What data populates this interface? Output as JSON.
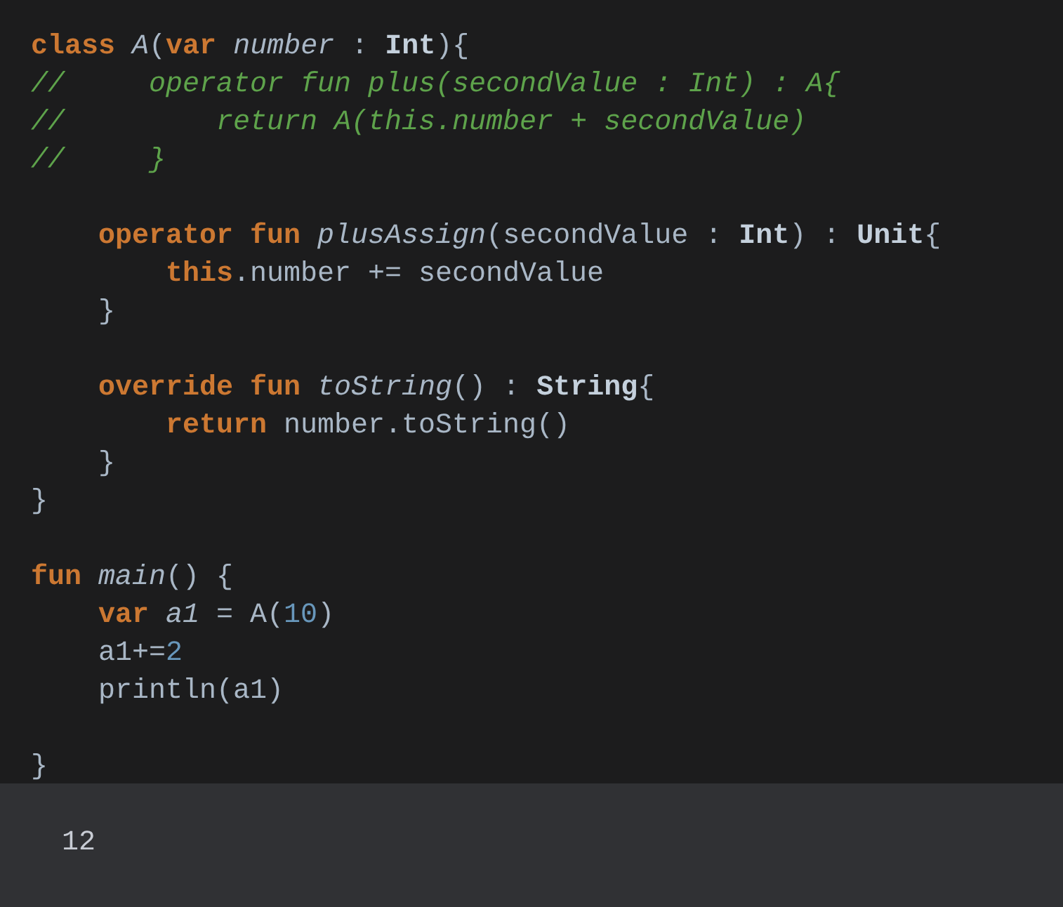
{
  "editor": {
    "lines": [
      {
        "kind": "top",
        "tokens": [
          {
            "kind": "keyword",
            "text": "class "
          },
          {
            "kind": "italic",
            "text": "A"
          },
          {
            "kind": "plain",
            "text": "("
          },
          {
            "kind": "keyword",
            "text": "var "
          },
          {
            "kind": "italic",
            "text": "number"
          },
          {
            "kind": "plain",
            "text": " : "
          },
          {
            "kind": "type",
            "text": "Int"
          },
          {
            "kind": "plain",
            "text": "){"
          }
        ]
      },
      {
        "kind": "top",
        "tokens": [
          {
            "kind": "comment",
            "text": "//     operator fun plus(secondValue : Int) : A{"
          }
        ]
      },
      {
        "kind": "top",
        "tokens": [
          {
            "kind": "comment",
            "text": "//         return A(this.number + secondValue)"
          }
        ]
      },
      {
        "kind": "top",
        "tokens": [
          {
            "kind": "comment",
            "text": "//     }"
          }
        ]
      },
      {
        "kind": "blank"
      },
      {
        "kind": "inner",
        "tokens": [
          {
            "kind": "keyword",
            "text": "operator fun "
          },
          {
            "kind": "italic",
            "text": "plusAssign"
          },
          {
            "kind": "plain",
            "text": "(secondValue : "
          },
          {
            "kind": "type",
            "text": "Int"
          },
          {
            "kind": "plain",
            "text": ") : "
          },
          {
            "kind": "type",
            "text": "Unit"
          },
          {
            "kind": "plain",
            "text": "{"
          }
        ]
      },
      {
        "kind": "deep",
        "tokens": [
          {
            "kind": "keyword",
            "text": "this"
          },
          {
            "kind": "plain",
            "text": ".number += secondValue"
          }
        ]
      },
      {
        "kind": "inner",
        "tokens": [
          {
            "kind": "plain",
            "text": "}"
          }
        ]
      },
      {
        "kind": "blank"
      },
      {
        "kind": "inner",
        "tokens": [
          {
            "kind": "keyword",
            "text": "override fun "
          },
          {
            "kind": "italic",
            "text": "toString"
          },
          {
            "kind": "plain",
            "text": "() : "
          },
          {
            "kind": "type",
            "text": "String"
          },
          {
            "kind": "plain",
            "text": "{"
          }
        ]
      },
      {
        "kind": "deep",
        "tokens": [
          {
            "kind": "keyword",
            "text": "return "
          },
          {
            "kind": "plain",
            "text": "number.toString()"
          }
        ]
      },
      {
        "kind": "inner",
        "tokens": [
          {
            "kind": "plain",
            "text": "}"
          }
        ]
      },
      {
        "kind": "top",
        "tokens": [
          {
            "kind": "plain",
            "text": "}"
          }
        ]
      },
      {
        "kind": "blank"
      },
      {
        "kind": "top",
        "tokens": [
          {
            "kind": "keyword",
            "text": "fun "
          },
          {
            "kind": "italic",
            "text": "main"
          },
          {
            "kind": "plain",
            "text": "() {"
          }
        ]
      },
      {
        "kind": "inner",
        "tokens": [
          {
            "kind": "keyword",
            "text": "var "
          },
          {
            "kind": "italic",
            "text": "a1"
          },
          {
            "kind": "plain",
            "text": " = A("
          },
          {
            "kind": "number",
            "text": "10"
          },
          {
            "kind": "plain",
            "text": ")"
          }
        ]
      },
      {
        "kind": "inner",
        "tokens": [
          {
            "kind": "plain",
            "text": "a1+="
          },
          {
            "kind": "number",
            "text": "2"
          }
        ]
      },
      {
        "kind": "inner",
        "tokens": [
          {
            "kind": "plain",
            "text": "println(a1)"
          }
        ]
      },
      {
        "kind": "blank"
      },
      {
        "kind": "top",
        "tokens": [
          {
            "kind": "plain",
            "text": "}"
          }
        ]
      }
    ]
  },
  "output": {
    "text": "12"
  }
}
